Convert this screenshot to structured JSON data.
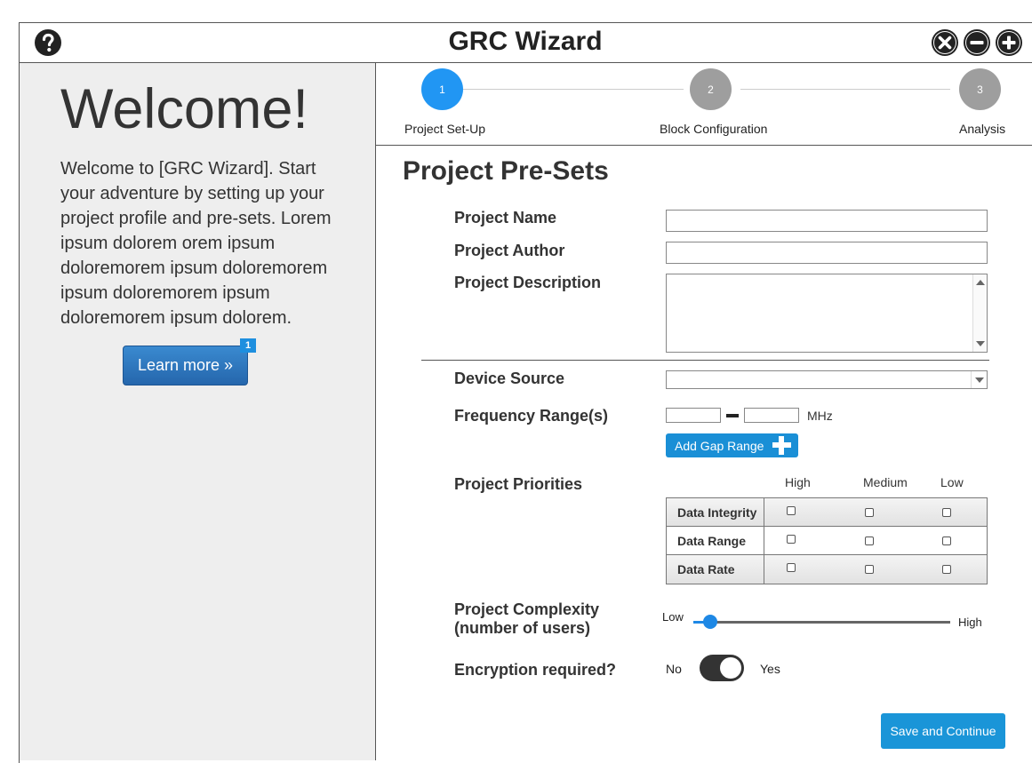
{
  "window": {
    "title": "GRC Wizard",
    "help_icon": "help-circle-icon",
    "controls": [
      "close-icon",
      "minimize-icon",
      "maximize-icon"
    ]
  },
  "sidebar": {
    "heading": "Welcome!",
    "body": "Welcome to [GRC Wizard]. Start your adventure by setting up your project profile and pre-sets. Lorem ipsum dolorem orem ipsum doloremorem ipsum doloremorem ipsum doloremorem ipsum doloremorem ipsum dolorem.",
    "learn_more": "Learn more »",
    "badge": "1"
  },
  "stepper": {
    "steps": [
      {
        "number": "1",
        "label": "Project Set-Up",
        "state": "active"
      },
      {
        "number": "2",
        "label": "Block Configuration",
        "state": "inactive"
      },
      {
        "number": "3",
        "label": "Analysis",
        "state": "inactive"
      }
    ],
    "active_color": "#2196f3",
    "inactive_color": "#9e9e9e"
  },
  "form": {
    "title": "Project Pre-Sets",
    "project_name": {
      "label": "Project Name",
      "value": ""
    },
    "project_author": {
      "label": "Project Author",
      "value": ""
    },
    "project_description": {
      "label": "Project Description",
      "value": ""
    },
    "device_source": {
      "label": "Device Source",
      "value": ""
    },
    "frequency": {
      "label": "Frequency Range(s)",
      "from": "",
      "to": "",
      "unit": "MHz",
      "add_gap_label": "Add Gap Range"
    },
    "priorities": {
      "label": "Project Priorities",
      "columns": [
        "High",
        "Medium",
        "Low"
      ],
      "rows": [
        {
          "label": "Data Integrity",
          "checked": [
            false,
            false,
            false
          ]
        },
        {
          "label": "Data Range",
          "checked": [
            false,
            false,
            false
          ]
        },
        {
          "label": "Data Rate",
          "checked": [
            false,
            false,
            false
          ]
        }
      ]
    },
    "complexity": {
      "label_line1": "Project Complexity",
      "label_line2": "(number of users)",
      "min_label": "Low",
      "max_label": "High",
      "value_fraction": 0.065
    },
    "encryption": {
      "label": "Encryption required?",
      "off_label": "No",
      "on_label": "Yes",
      "state": "on"
    },
    "save_label": "Save and Continue"
  },
  "colors": {
    "primary_button": "#1a95d8",
    "sidebar_bg": "#eeeeee",
    "learn_more_bg": "#2a73ba"
  }
}
